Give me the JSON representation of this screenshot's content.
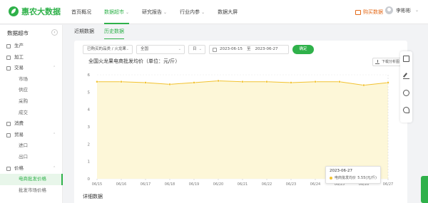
{
  "app": {
    "logo_text": "惠农大数据",
    "brand_color": "#2fb14a"
  },
  "nav": [
    {
      "label": "首页概况",
      "dropdown": false,
      "active": false
    },
    {
      "label": "数据超市",
      "dropdown": true,
      "active": true
    },
    {
      "label": "研究报告",
      "dropdown": true,
      "active": false
    },
    {
      "label": "行业内参",
      "dropdown": true,
      "active": false
    },
    {
      "label": "数据大屏",
      "dropdown": false,
      "active": false
    }
  ],
  "header": {
    "buy_label": "购买数据",
    "user_name": "李彬彬"
  },
  "sidebar": {
    "title": "数据超市",
    "items": [
      {
        "label": "生产",
        "type": "group",
        "expandable": false
      },
      {
        "label": "加工",
        "type": "group",
        "expandable": false
      },
      {
        "label": "交易",
        "type": "group",
        "expandable": true
      },
      {
        "label": "市场",
        "type": "sub"
      },
      {
        "label": "供应",
        "type": "sub"
      },
      {
        "label": "采购",
        "type": "sub"
      },
      {
        "label": "成交",
        "type": "sub"
      },
      {
        "label": "消费",
        "type": "group",
        "expandable": false
      },
      {
        "label": "贸易",
        "type": "group",
        "expandable": true
      },
      {
        "label": "进口",
        "type": "sub"
      },
      {
        "label": "出口",
        "type": "sub"
      },
      {
        "label": "价格",
        "type": "group",
        "expandable": true
      },
      {
        "label": "电商批发价格",
        "type": "sub",
        "active": true
      },
      {
        "label": "批发市场价格",
        "type": "sub"
      }
    ]
  },
  "tabs": [
    {
      "label": "近期数据",
      "active": false
    },
    {
      "label": "历史数据",
      "active": true
    }
  ],
  "filters": {
    "product": "已购买的品类 / 火龙果",
    "region": "全国",
    "granularity": "日",
    "date_start": "2023-06-15",
    "date_sep": "至",
    "date_end": "2023-06-27",
    "query_label": "确定"
  },
  "download_label": "下载分析图",
  "chart_data": {
    "type": "area",
    "title": "全国火龙果电商批发均价（单位：元/斤）",
    "x": [
      "06/15",
      "06/16",
      "06/17",
      "06/18",
      "06/19",
      "06/20",
      "06/21",
      "06/22",
      "06/23",
      "06/24",
      "06/25",
      "06/26",
      "06/27"
    ],
    "series": [
      {
        "name": "电商批发均价",
        "values": [
          5.6,
          5.6,
          5.55,
          5.45,
          5.55,
          5.65,
          5.6,
          5.6,
          5.55,
          5.6,
          5.6,
          5.4,
          5.55
        ]
      }
    ],
    "ylim": [
      0,
      6
    ],
    "yticks": [
      0,
      1,
      2,
      3,
      4,
      5,
      6
    ],
    "line_color": "#f2c230",
    "fill_color": "#fdf7d8",
    "grid": true
  },
  "tooltip": {
    "date": "2023-06-27",
    "series": "电商批发均价",
    "value": "5.55(元/斤)"
  },
  "detail_title": "详细数据",
  "float_bar": [
    "calculator-icon",
    "edit-icon",
    "headset-icon",
    "phone-icon"
  ]
}
